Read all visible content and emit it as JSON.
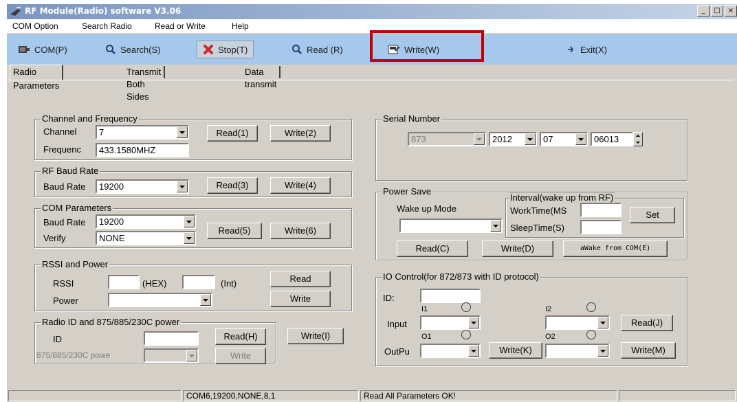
{
  "window": {
    "title": "RF Module(Radio) software  V3.06",
    "minimize": "_",
    "maximize": "□",
    "close": "×"
  },
  "menu": [
    "COM Option",
    "Search Radio",
    "Read or Write",
    "Help"
  ],
  "toolbar": {
    "com": "COM(P)",
    "search": "Search(S)",
    "stop": "Stop(T)",
    "read": "Read (R)",
    "write": "Write(W)",
    "exit": "Exit(X)"
  },
  "tabs": [
    "Radio Parameters",
    "Transmit Both Sides",
    "Data transmit"
  ],
  "channel_freq": {
    "title": "Channel and Frequency",
    "channel_label": "Channel",
    "channel_value": "7",
    "freq_label": "Frequenc",
    "freq_value": "433.1580MHZ",
    "read": "Read(1)",
    "write": "Write(2)"
  },
  "rf_baud": {
    "title": "RF Baud Rate",
    "label": "Baud Rate",
    "value": "19200",
    "read": "Read(3)",
    "write": "Write(4)"
  },
  "com_params": {
    "title": "COM Parameters",
    "baud_label": "Baud Rate",
    "baud_value": "19200",
    "verify_label": "Verify",
    "verify_value": "NONE",
    "read": "Read(5)",
    "write": "Write(6)"
  },
  "rssi": {
    "title": "RSSI and Power",
    "rssi_label": "RSSI",
    "hex_label": "(HEX)",
    "int_label": "(Int)",
    "power_label": "Power",
    "read": "Read",
    "write": "Write"
  },
  "radio_id": {
    "title": "Radio ID and 875/885/230C power",
    "id_label": "ID",
    "power_label": "875/885/230C powe",
    "read": "Read(H)",
    "write": "Write(I)",
    "write2": "Write"
  },
  "serial": {
    "title": "Serial Number",
    "model": "873",
    "year": "2012",
    "month": "07",
    "number": "06013"
  },
  "power_save": {
    "title": "Power Save",
    "wake_mode_label": "Wake up Mode",
    "interval_title": "Interval(wake up from RF)",
    "worktime_label": "WorkTime(MS",
    "sleeptime_label": "SleepTime(S)",
    "set": "Set",
    "read": "Read(C)",
    "write": "Write(D)",
    "wake": "aWake from COM(E)"
  },
  "io": {
    "title": "IO Control(for 872/873 with ID protocol)",
    "id_label": "ID:",
    "i1": "I1",
    "i2": "I2",
    "o1": "O1",
    "o2": "O2",
    "input_label": "Input",
    "output_label": "OutPu",
    "read": "Read(J)",
    "write_k": "Write(K)",
    "write_m": "Write(M)"
  },
  "status": {
    "port": "COM6,19200,NONE,8,1",
    "message": "Read All Parameters OK!"
  },
  "colors": {
    "toolbar": "#a6c8ec",
    "highlight": "#c00000",
    "face": "#d4d0c8"
  }
}
